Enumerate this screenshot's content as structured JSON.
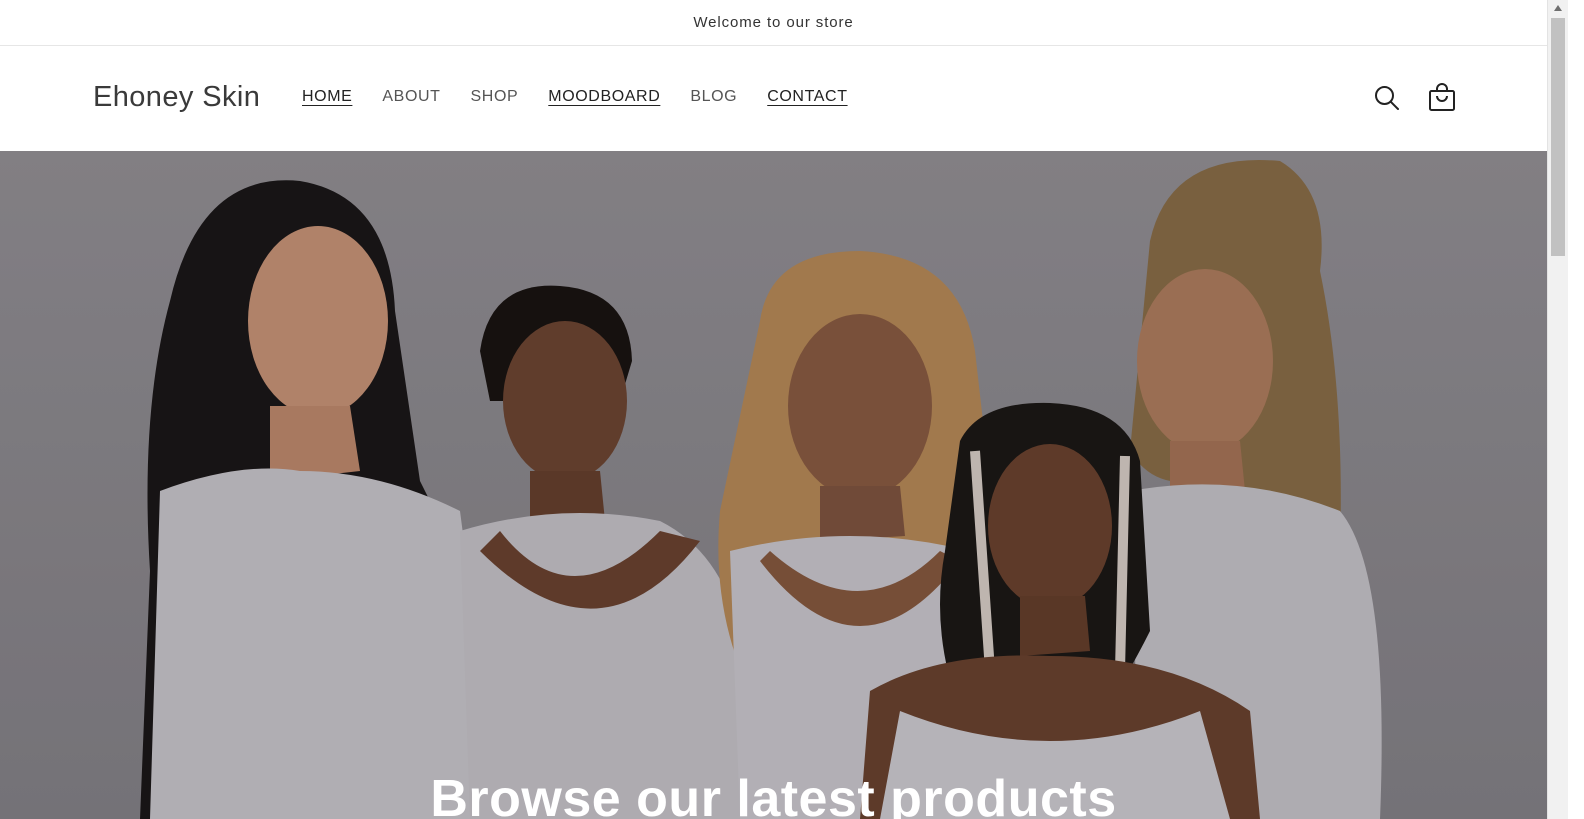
{
  "announcement": {
    "text": "Welcome to our store"
  },
  "header": {
    "logo": "Ehoney Skin",
    "nav": [
      {
        "label": "HOME",
        "underlined": true
      },
      {
        "label": "ABOUT",
        "underlined": false
      },
      {
        "label": "SHOP",
        "underlined": false
      },
      {
        "label": "MOODBOARD",
        "underlined": true
      },
      {
        "label": "BLOG",
        "underlined": false
      },
      {
        "label": "CONTACT",
        "underlined": true
      }
    ],
    "icons": [
      "search-icon",
      "cart-icon"
    ]
  },
  "hero": {
    "heading": "Browse our latest products",
    "image_subject": "five women in white t-shirts posing together on a grey backdrop"
  },
  "colors": {
    "text": "#121212",
    "nav_muted": "#555555",
    "hero_backdrop": "#8e8b90",
    "heading": "#ffffff"
  }
}
